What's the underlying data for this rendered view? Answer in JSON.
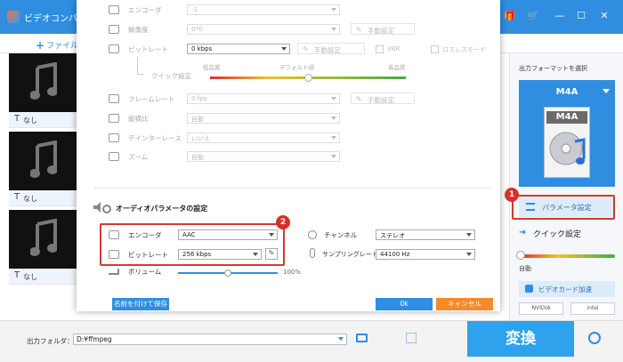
{
  "app": {
    "title": "ビデオコンバ"
  },
  "toolbar": {
    "add_file_label": "ファイル"
  },
  "file_list": {
    "items": [
      {
        "subtitle": "なし"
      },
      {
        "subtitle": "なし"
      },
      {
        "subtitle": "なし"
      }
    ]
  },
  "dialog": {
    "video": {
      "encoder": {
        "label": "エンコーダ",
        "value": "-1"
      },
      "resolution": {
        "label": "解像度",
        "value": "0*0",
        "edit_label": "手動設定"
      },
      "bitrate": {
        "label": "ビットレート",
        "value": "0 kbps",
        "edit_label": "手動設定",
        "vbr_label": "VBR",
        "lossless_label": "ロスレスモード"
      },
      "quick_settings": {
        "label": "クイック設定",
        "low": "低品質",
        "default": "デフォルト値",
        "high": "高品質",
        "level_fraction": 0.5
      },
      "framerate": {
        "label": "フレームレート",
        "value": "0 fps",
        "edit_label": "手動設定"
      },
      "aspect": {
        "label": "縦横比",
        "value": "自動"
      },
      "deinterlace": {
        "label": "デインターレース",
        "value": "いいえ"
      },
      "zoom": {
        "label": "ズーム",
        "value": "自動"
      }
    },
    "audio": {
      "section_title": "オーディオパラメータの設定",
      "encoder": {
        "label": "エンコーダ",
        "value": "AAC"
      },
      "bitrate": {
        "label": "ビットレート",
        "value": "256 kbps"
      },
      "channel": {
        "label": "チャンネル",
        "value": "ステレオ"
      },
      "samplerate": {
        "label": "サンプリングレート",
        "value": "44100 Hz"
      },
      "volume": {
        "label": "ボリューム",
        "value": "100%",
        "level_fraction": 0.5
      }
    },
    "buttons": {
      "save_as": "名前を付けて保存",
      "ok": "0k",
      "cancel": "キャンセル"
    }
  },
  "right_panel": {
    "format_title": "出力フォーマットを選択",
    "format_name": "M4A",
    "format_icon_label": "M4A",
    "param_settings_label": "パラメータ設定",
    "quick_settings_label": "クイック設定",
    "gpu_speed_label": "自動",
    "gpu_accel_label": "ビデオカード加速",
    "vendors": [
      "NVIDIA",
      "intel"
    ]
  },
  "bottom": {
    "output_folder_label": "出力フォルダ：",
    "output_folder_path": "D:¥ffmpeg",
    "convert_label": "変換"
  },
  "annotations": {
    "badge1": "1",
    "badge2": "2"
  },
  "colors": {
    "accent": "#2f8ee0",
    "convert": "#2ea2ec",
    "cancel": "#f58a2a",
    "highlight": "#d23a32"
  }
}
